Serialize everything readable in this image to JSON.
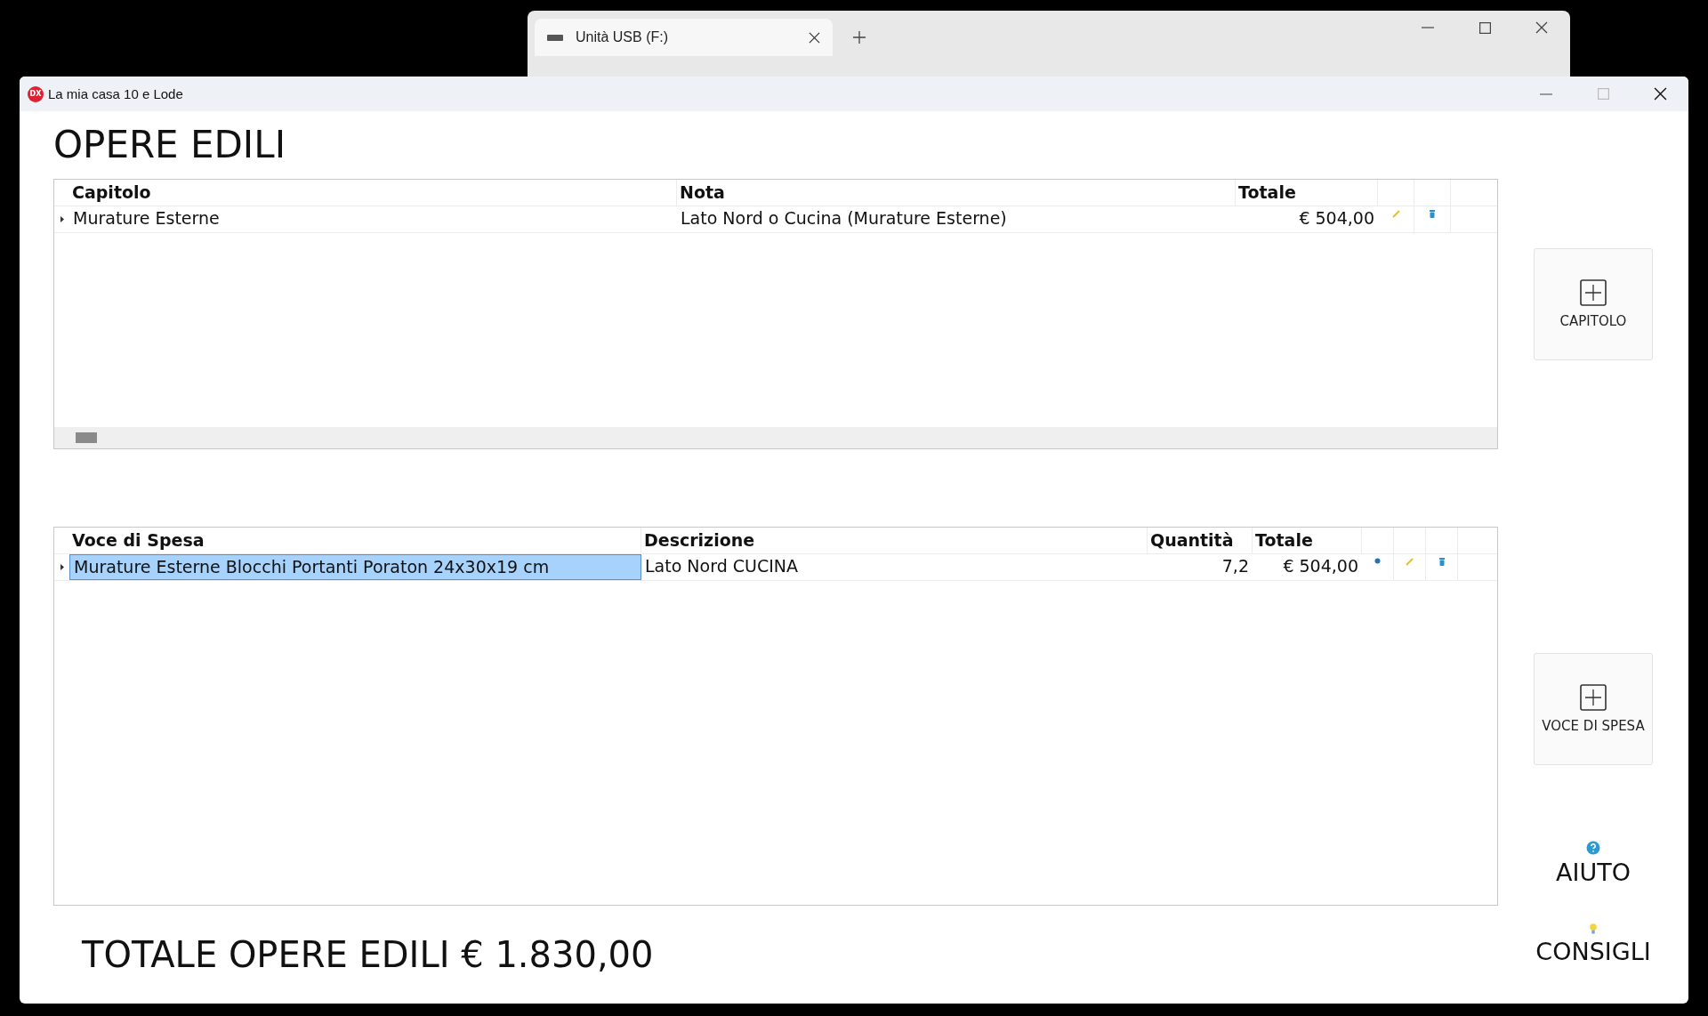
{
  "background_window": {
    "tab": {
      "label": "Unità USB (F:)",
      "selected": true
    }
  },
  "window": {
    "title": "La mia casa 10 e Lode",
    "app_icon": "DX"
  },
  "heading": "OPERE EDILI",
  "capitoli": {
    "columns": [
      {
        "label": "Capitolo",
        "numeric": false
      },
      {
        "label": "Nota",
        "numeric": false
      },
      {
        "label": "Totale",
        "numeric": true
      }
    ],
    "actions": [
      {
        "kind": "edit"
      },
      {
        "kind": "delete"
      }
    ],
    "rows": [
      {
        "cells": [
          {
            "text": "Murature Esterne",
            "selected": false
          },
          {
            "text": "Lato Nord o Cucina (Murature Esterne)",
            "selected": false
          },
          {
            "text": "€ 504,00",
            "selected": false
          }
        ]
      }
    ]
  },
  "voci": {
    "columns": [
      {
        "label": "Voce di Spesa",
        "numeric": false
      },
      {
        "label": "Descrizione",
        "numeric": false
      },
      {
        "label": "Quantità",
        "numeric": true
      },
      {
        "label": "Totale",
        "numeric": true
      }
    ],
    "actions": [
      {
        "kind": "view"
      },
      {
        "kind": "edit"
      },
      {
        "kind": "delete"
      }
    ],
    "rows": [
      {
        "cells": [
          {
            "text": "Murature Esterne Blocchi Portanti Poraton 24x30x19 cm",
            "selected": true
          },
          {
            "text": "Lato Nord CUCINA",
            "selected": false
          },
          {
            "text": "7,2",
            "selected": false
          },
          {
            "text": "€ 504,00",
            "selected": false
          }
        ]
      }
    ]
  },
  "total": "TOTALE OPERE EDILI € 1.830,00",
  "buttons": [
    {
      "label": "CAPITOLO"
    },
    {
      "label": "VOCE DI SPESA"
    }
  ],
  "links": [
    {
      "kind": "help",
      "label": "AIUTO"
    },
    {
      "kind": "tips",
      "label": "CONSIGLI"
    }
  ]
}
